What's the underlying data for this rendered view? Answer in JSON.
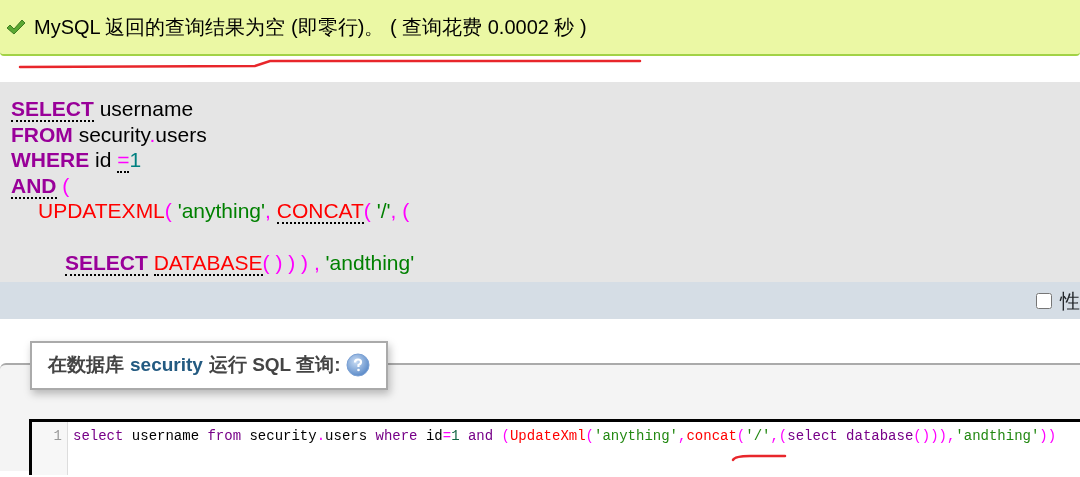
{
  "message": {
    "kind": "success",
    "text": "MySQL 返回的查询结果为空 (即零行)。 ( 查询花费 0.0002 秒 )"
  },
  "sql_display": {
    "lines": [
      {
        "tokens": [
          {
            "kind": "keyword",
            "text": "SELECT",
            "doc": true
          },
          {
            "kind": "plain",
            "text": " username",
            "doc": false
          }
        ]
      },
      {
        "tokens": [
          {
            "kind": "keyword",
            "text": "FROM",
            "doc": false
          },
          {
            "kind": "plain",
            "text": " security",
            "doc": false
          },
          {
            "kind": "punct",
            "text": ".",
            "doc": false
          },
          {
            "kind": "plain",
            "text": "users",
            "doc": false
          }
        ]
      },
      {
        "tokens": [
          {
            "kind": "keyword",
            "text": "WHERE",
            "doc": false
          },
          {
            "kind": "plain",
            "text": " id ",
            "doc": false
          },
          {
            "kind": "punct",
            "text": "=",
            "doc": true
          },
          {
            "kind": "number",
            "text": "1",
            "doc": false
          }
        ]
      },
      {
        "tokens": [
          {
            "kind": "keyword",
            "text": "AND",
            "doc": true
          },
          {
            "kind": "punct",
            "text": " (",
            "doc": false
          }
        ],
        "children": [
          {
            "tokens": [
              {
                "kind": "function",
                "text": "UPDATEXML",
                "doc": false
              },
              {
                "kind": "punct",
                "text": "( ",
                "doc": false
              },
              {
                "kind": "string",
                "text": "'anything'",
                "doc": false
              },
              {
                "kind": "punct",
                "text": ", ",
                "doc": false
              },
              {
                "kind": "function",
                "text": "CONCAT",
                "doc": true
              },
              {
                "kind": "punct",
                "text": "( ",
                "doc": false
              },
              {
                "kind": "string",
                "text": "'/'",
                "doc": false
              },
              {
                "kind": "punct",
                "text": ", (",
                "doc": false
              }
            ],
            "children": [
              {
                "blank_before": true,
                "tokens": [
                  {
                    "kind": "keyword",
                    "text": "SELECT",
                    "doc": true
                  },
                  {
                    "kind": "function",
                    "text": " DATABASE",
                    "doc": true
                  },
                  {
                    "kind": "punct",
                    "text": "( ) ) ) , ",
                    "doc": false
                  },
                  {
                    "kind": "string",
                    "text": "'andthing'",
                    "doc": false
                  }
                ]
              }
            ]
          }
        ]
      }
    ]
  },
  "options_bar": {
    "checkbox": {
      "label": "性",
      "checked": false
    }
  },
  "query_panel": {
    "legend_before": "在数据库",
    "database": "security",
    "legend_after": "运行 SQL 查询:",
    "editor": {
      "lines": [
        {
          "number": "1",
          "tokens": [
            {
              "kind": "keyword",
              "text": "select"
            },
            {
              "kind": "plain",
              "text": " username "
            },
            {
              "kind": "keyword",
              "text": "from"
            },
            {
              "kind": "plain",
              "text": " security"
            },
            {
              "kind": "punct",
              "text": "."
            },
            {
              "kind": "plain",
              "text": "users "
            },
            {
              "kind": "keyword",
              "text": "where"
            },
            {
              "kind": "plain",
              "text": " id"
            },
            {
              "kind": "punct",
              "text": "="
            },
            {
              "kind": "number",
              "text": "1"
            },
            {
              "kind": "keyword",
              "text": " and"
            },
            {
              "kind": "punct",
              "text": " ("
            },
            {
              "kind": "function",
              "text": "UpdateXml"
            },
            {
              "kind": "punct",
              "text": "("
            },
            {
              "kind": "string",
              "text": "'anything'"
            },
            {
              "kind": "punct",
              "text": ","
            },
            {
              "kind": "function",
              "text": "concat"
            },
            {
              "kind": "punct",
              "text": "("
            },
            {
              "kind": "string",
              "text": "'/'"
            },
            {
              "kind": "punct",
              "text": ",("
            },
            {
              "kind": "keyword",
              "text": "select"
            },
            {
              "kind": "keyword",
              "text": " database"
            },
            {
              "kind": "punct",
              "text": "()))"
            },
            {
              "kind": "punct",
              "text": ","
            },
            {
              "kind": "string",
              "text": "'andthing'"
            },
            {
              "kind": "punct",
              "text": "))"
            }
          ]
        }
      ]
    }
  }
}
